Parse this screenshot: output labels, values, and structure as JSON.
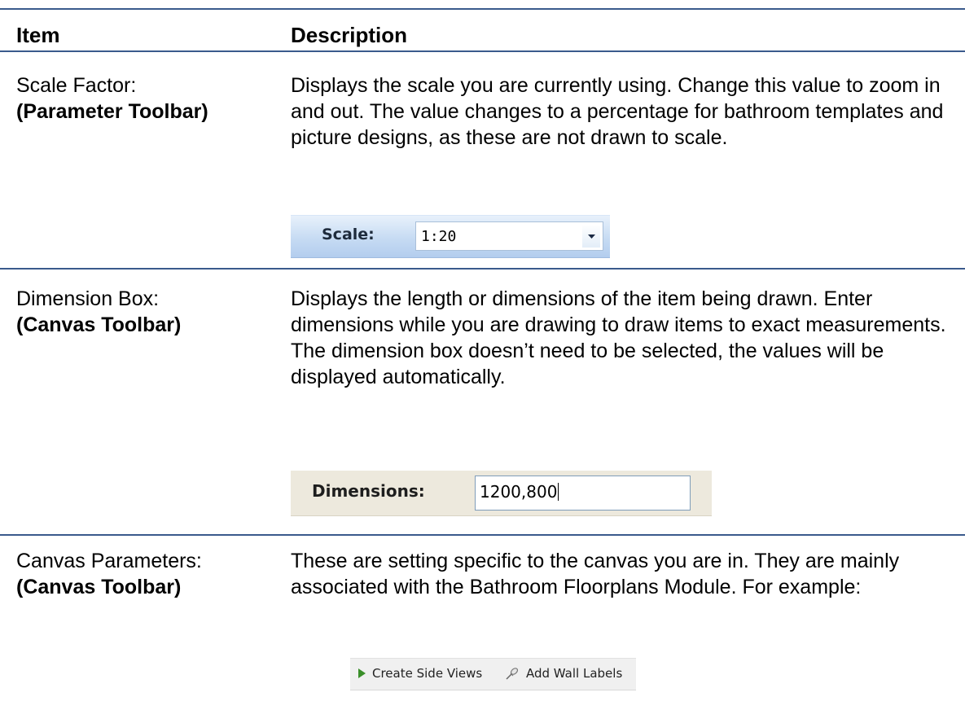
{
  "table": {
    "headers": {
      "item": "Item",
      "description": "Description"
    },
    "rows": [
      {
        "item_name": "Scale Factor:",
        "item_toolbar": "(Parameter Toolbar)",
        "description": "Displays the scale you are currently using. Change this value to zoom in and out. The value changes to a percentage for bathroom templates and picture designs, as these are not drawn to scale."
      },
      {
        "item_name": "Dimension Box:",
        "item_toolbar": "(Canvas Toolbar)",
        "description": "Displays the length or dimensions of the item being drawn. Enter dimensions while you are drawing to draw items to exact measurements. The dimension box doesn’t need to be selected, the values will be displayed automatically."
      },
      {
        "item_name": "Canvas Parameters:",
        "item_toolbar": "(Canvas Toolbar)",
        "description": "These are setting specific to the canvas you are in. They are mainly associated with the Bathroom Floorplans Module. For example:"
      }
    ]
  },
  "scale_widget": {
    "label": "Scale:",
    "value": "1:20",
    "dropdown_icon": "chevron-down-icon"
  },
  "dimension_widget": {
    "label": "Dimensions:",
    "value": "1200,800"
  },
  "canvas_toolbar": {
    "create_side_views": "Create Side Views",
    "add_wall_labels": "Add Wall Labels",
    "icons": [
      "play-arrow-icon",
      "pin-icon"
    ],
    "colors": {
      "arrow_green": "#3a8f2a"
    }
  },
  "colors": {
    "rule": "#3a5a8c",
    "scale_bar": "#c6dbf3",
    "dimension_bar": "#ede9dd"
  }
}
